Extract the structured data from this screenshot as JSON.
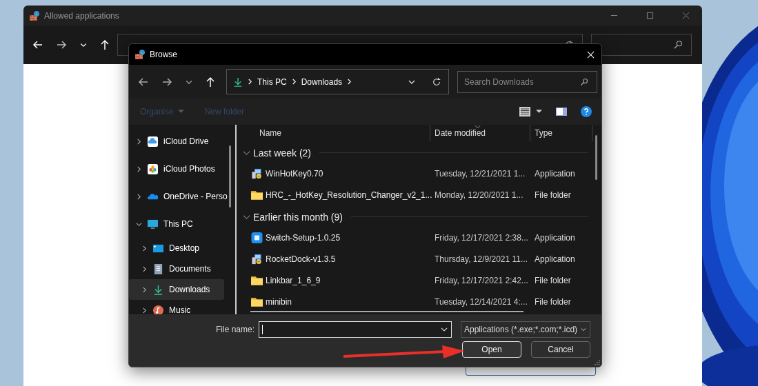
{
  "background_window": {
    "title": "Allowed applications"
  },
  "dialog": {
    "title": "Browse",
    "address": [
      "This PC",
      "Downloads"
    ],
    "search": {
      "placeholder": "Search Downloads"
    },
    "commands": [
      {
        "label": "Organise",
        "disabled": true,
        "dropdown": true
      },
      {
        "label": "New folder",
        "disabled": true,
        "dropdown": false
      }
    ],
    "sidebar": [
      {
        "label": "iCloud Drive",
        "kind": "icloud",
        "expanded": false,
        "selected": false
      },
      {
        "label": "iCloud Photos",
        "kind": "photos",
        "expanded": false,
        "selected": false
      },
      {
        "label": "OneDrive - Perso",
        "kind": "onedrive",
        "expanded": false,
        "selected": false
      },
      {
        "label": "This PC",
        "kind": "pc",
        "expanded": true,
        "selected": false,
        "children": [
          {
            "label": "Desktop",
            "kind": "desktop",
            "expanded": false,
            "selected": false
          },
          {
            "label": "Documents",
            "kind": "documents",
            "expanded": false,
            "selected": false
          },
          {
            "label": "Downloads",
            "kind": "downloads",
            "expanded": false,
            "selected": true
          },
          {
            "label": "Music",
            "kind": "music",
            "expanded": false,
            "selected": false
          }
        ]
      }
    ],
    "columns": [
      {
        "label": "Name",
        "sorted": false
      },
      {
        "label": "Date modified",
        "sorted": true
      },
      {
        "label": "Type",
        "sorted": false
      }
    ],
    "groups": [
      {
        "label": "Last week (2)",
        "expanded": true,
        "files": [
          {
            "name": "WinHotKey0.70",
            "date": "Tuesday, 12/21/2021 1...",
            "type": "Application",
            "kind": "installer"
          },
          {
            "name": "HRC_-_HotKey_Resolution_Changer_v2_1...",
            "date": "Monday, 12/20/2021 1...",
            "type": "File folder",
            "kind": "folder"
          }
        ]
      },
      {
        "label": "Earlier this month (9)",
        "expanded": true,
        "files": [
          {
            "name": "Switch-Setup-1.0.25",
            "date": "Friday, 12/17/2021 2:38...",
            "type": "Application",
            "kind": "app"
          },
          {
            "name": "RocketDock-v1.3.5",
            "date": "Thursday, 12/9/2021 11...",
            "type": "Application",
            "kind": "installer"
          },
          {
            "name": "Linkbar_1_6_9",
            "date": "Friday, 12/17/2021 2:42...",
            "type": "File folder",
            "kind": "folder"
          },
          {
            "name": "minibin",
            "date": "Tuesday, 12/14/2021 4:...",
            "type": "File folder",
            "kind": "folder"
          }
        ]
      }
    ],
    "file_name": {
      "label": "File name:"
    },
    "filter": "Applications (*.exe;*.com;*.icd)",
    "buttons": [
      {
        "label": "Open",
        "default": true
      },
      {
        "label": "Cancel",
        "default": false
      }
    ]
  }
}
